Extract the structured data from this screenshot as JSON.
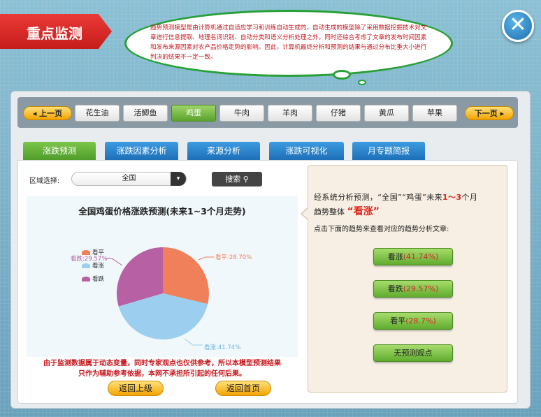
{
  "header": {
    "title": "重点监测",
    "close_label": "✕"
  },
  "bubble": {
    "text": "趋势预测模型是由计算机通过自适应学习和训练自动生成的。自动生成的模型除了采用数据挖掘技术对文章进行信息提取、地理名词识别、自动分类和语义分析处理之外，同时还综合考虑了文章的发布时间因素和发布来源因素对农产品价格走势的影响。因此，计算机最终分析和预测的结果与通过分布比重大小进行判决的结果不一定一致。"
  },
  "nav": {
    "prev_label": "上一页",
    "next_label": "下一页",
    "products": [
      "花生油",
      "活鲫鱼",
      "鸡蛋",
      "牛肉",
      "羊肉",
      "仔猪",
      "黄瓜",
      "苹果"
    ],
    "active": "鸡蛋"
  },
  "tabs": [
    "涨跌预测",
    "涨跌因素分析",
    "来源分析",
    "涨跌可视化",
    "月专题简报"
  ],
  "filter": {
    "label": "区域选择:",
    "value": "全国",
    "search_label": "搜索"
  },
  "chart_data": {
    "type": "pie",
    "title": "全国鸡蛋价格涨跌预测(未来1~3个月走势)",
    "slices": [
      {
        "name": "看平",
        "value": 28.7,
        "color": "#f0805a"
      },
      {
        "name": "看涨",
        "value": 41.74,
        "color": "#9ccfef"
      },
      {
        "name": "看跌",
        "value": 29.57,
        "color": "#b860a4"
      }
    ],
    "labels": [
      "看平:28.70%",
      "看涨:41.74%",
      "看跌:29.57%"
    ],
    "legend": "left"
  },
  "disclaimer": {
    "line1": "由于监测数据属于动态变量，同时专家观点也仅供参考，所以本模型预测结果",
    "line2": "只作为辅助参考依据，本网不承担所引起的任何后果。"
  },
  "buttons": {
    "back": "返回上级",
    "home": "返回首页"
  },
  "side": {
    "line1_pre": "经系统分析预测，“全国”“鸡蛋”未来",
    "line1_red": "1～3",
    "line1_post": "个月",
    "line2_pre": "趋势整体",
    "line2_red": "“看涨”",
    "line3": "点击下面的趋势来查看对应的趋势分析文章:",
    "trend_buttons": [
      {
        "label": "看涨",
        "pct": "(41.74%)"
      },
      {
        "label": "看跌",
        "pct": "(29.57%)"
      },
      {
        "label": "看平",
        "pct": "(28.7%)"
      },
      {
        "label": "无预测观点",
        "pct": ""
      }
    ]
  }
}
